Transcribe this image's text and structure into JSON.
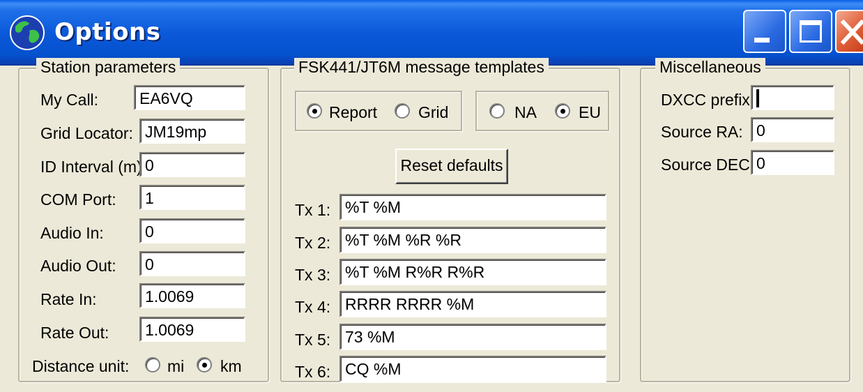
{
  "window": {
    "title": "Options"
  },
  "station": {
    "legend": "Station parameters",
    "fields": [
      {
        "label": "My Call:",
        "value": "EA6VQ"
      },
      {
        "label": "Grid Locator:",
        "value": "JM19mp"
      },
      {
        "label": "ID Interval (m):",
        "value": "0"
      },
      {
        "label": "COM Port:",
        "value": "1"
      },
      {
        "label": "Audio In:",
        "value": "0"
      },
      {
        "label": "Audio Out:",
        "value": "0"
      },
      {
        "label": "Rate In:",
        "value": "1.0069"
      },
      {
        "label": "Rate Out:",
        "value": "1.0069"
      }
    ],
    "distance": {
      "label": "Distance unit:",
      "options": [
        "mi",
        "km"
      ],
      "selected": "km"
    }
  },
  "templates": {
    "legend": "FSK441/JT6M message templates",
    "format": {
      "options": [
        "Report",
        "Grid"
      ],
      "selected": "Report"
    },
    "region": {
      "options": [
        "NA",
        "EU"
      ],
      "selected": "EU"
    },
    "reset_label": "Reset defaults",
    "tx": [
      {
        "label": "Tx 1:",
        "value": "%T %M"
      },
      {
        "label": "Tx 2:",
        "value": "%T %M %R %R"
      },
      {
        "label": "Tx 3:",
        "value": "%T %M R%R R%R"
      },
      {
        "label": "Tx 4:",
        "value": "RRRR RRRR %M"
      },
      {
        "label": "Tx 5:",
        "value": "73 %M"
      },
      {
        "label": "Tx 6:",
        "value": "CQ %M"
      }
    ]
  },
  "misc": {
    "legend": "Miscellaneous",
    "fields": [
      {
        "label": "DXCC prefix:",
        "value": ""
      },
      {
        "label": "Source RA:",
        "value": "0"
      },
      {
        "label": "Source DEC:",
        "value": "0"
      }
    ]
  },
  "colors": {
    "titlebar": "#0a58d8",
    "face": "#ece9d8",
    "close": "#e0603a"
  },
  "icons": [
    "globe-icon",
    "minimize-icon",
    "maximize-icon",
    "close-icon",
    "text-caret"
  ]
}
